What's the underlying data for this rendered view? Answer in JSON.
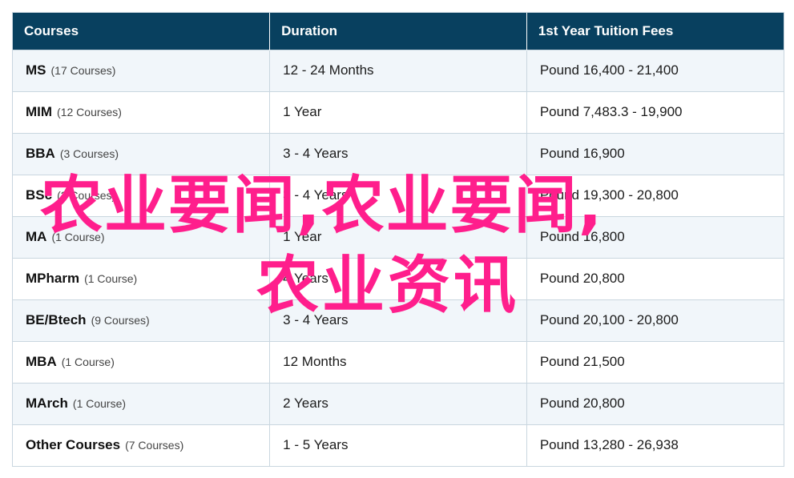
{
  "table": {
    "headers": [
      "Courses",
      "Duration",
      "1st Year Tuition Fees"
    ],
    "rows": [
      {
        "name": "MS",
        "count": "(17 Courses)",
        "duration": "12 - 24 Months",
        "fees": "Pound 16,400 - 21,400"
      },
      {
        "name": "MIM",
        "count": "(12 Courses)",
        "duration": "1 Year",
        "fees": "Pound 7,483.3 - 19,900"
      },
      {
        "name": "BBA",
        "count": "(3 Courses)",
        "duration": "3 - 4 Years",
        "fees": "Pound 16,900"
      },
      {
        "name": "BSc",
        "count": "(2 Courses)",
        "duration": "3 - 4 Years",
        "fees": "Pound 19,300 - 20,800"
      },
      {
        "name": "MA",
        "count": "(1 Course)",
        "duration": "1 Year",
        "fees": "Pound 16,800"
      },
      {
        "name": "MPharm",
        "count": "(1 Course)",
        "duration": "4 Years",
        "fees": "Pound 20,800"
      },
      {
        "name": "BE/Btech",
        "count": "(9 Courses)",
        "duration": "3 - 4 Years",
        "fees": "Pound 20,100 - 20,800"
      },
      {
        "name": "MBA",
        "count": "(1 Course)",
        "duration": "12 Months",
        "fees": "Pound 21,500"
      },
      {
        "name": "MArch",
        "count": "(1 Course)",
        "duration": "2 Years",
        "fees": "Pound 20,800"
      },
      {
        "name": "Other Courses",
        "count": "(7 Courses)",
        "duration": "1 - 5 Years",
        "fees": "Pound 13,280 - 26,938"
      }
    ]
  },
  "watermark": {
    "line1": "农业要闻,农业要闻,",
    "line2": "农业资讯"
  },
  "colors": {
    "header_bg": "#08405f",
    "row_alt_bg": "#f1f6fa",
    "watermark": "#ff1e8c"
  }
}
